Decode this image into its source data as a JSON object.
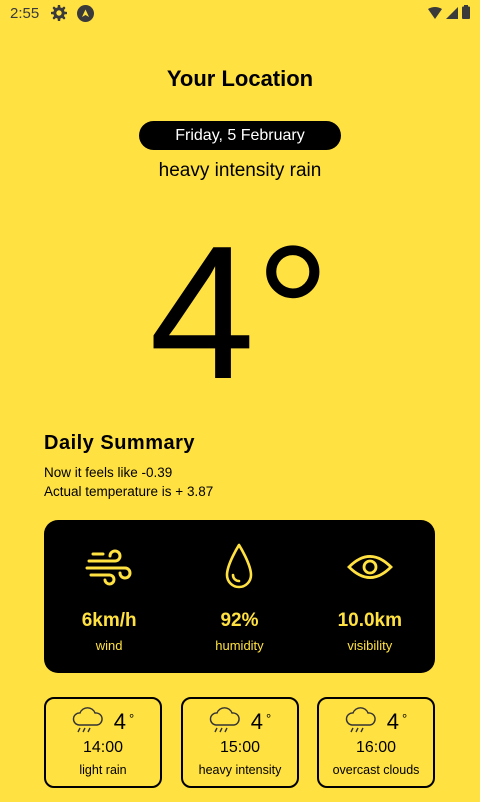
{
  "status_bar": {
    "time": "2:55",
    "icons_left": [
      "gear-icon",
      "navigation-a-icon"
    ],
    "icons_right": [
      "wifi-icon",
      "signal-icon",
      "battery-icon"
    ]
  },
  "header": {
    "title": "Your Location",
    "date": "Friday, 5 February",
    "condition": "heavy intensity rain"
  },
  "current": {
    "temperature": "4°"
  },
  "summary": {
    "title": "Daily Summary",
    "feels_like": "Now it feels like  -0.39",
    "actual": "Actual temperature is + 3.87"
  },
  "stats": [
    {
      "icon": "wind-icon",
      "value": "6km/h",
      "label": "wind"
    },
    {
      "icon": "water-drop-icon",
      "value": "92%",
      "label": "humidity"
    },
    {
      "icon": "eye-icon",
      "value": "10.0km",
      "label": "visibility"
    }
  ],
  "forecast": [
    {
      "icon": "rain-cloud-icon",
      "temp": "4",
      "unit": "°",
      "time": "14:00",
      "desc": "light rain"
    },
    {
      "icon": "rain-cloud-icon",
      "temp": "4",
      "unit": "°",
      "time": "15:00",
      "desc": "heavy intensity"
    },
    {
      "icon": "rain-cloud-icon",
      "temp": "4",
      "unit": "°",
      "time": "16:00",
      "desc": "overcast clouds"
    }
  ],
  "colors": {
    "background": "#FFE142",
    "card": "#000000",
    "accent": "#FFE142"
  }
}
